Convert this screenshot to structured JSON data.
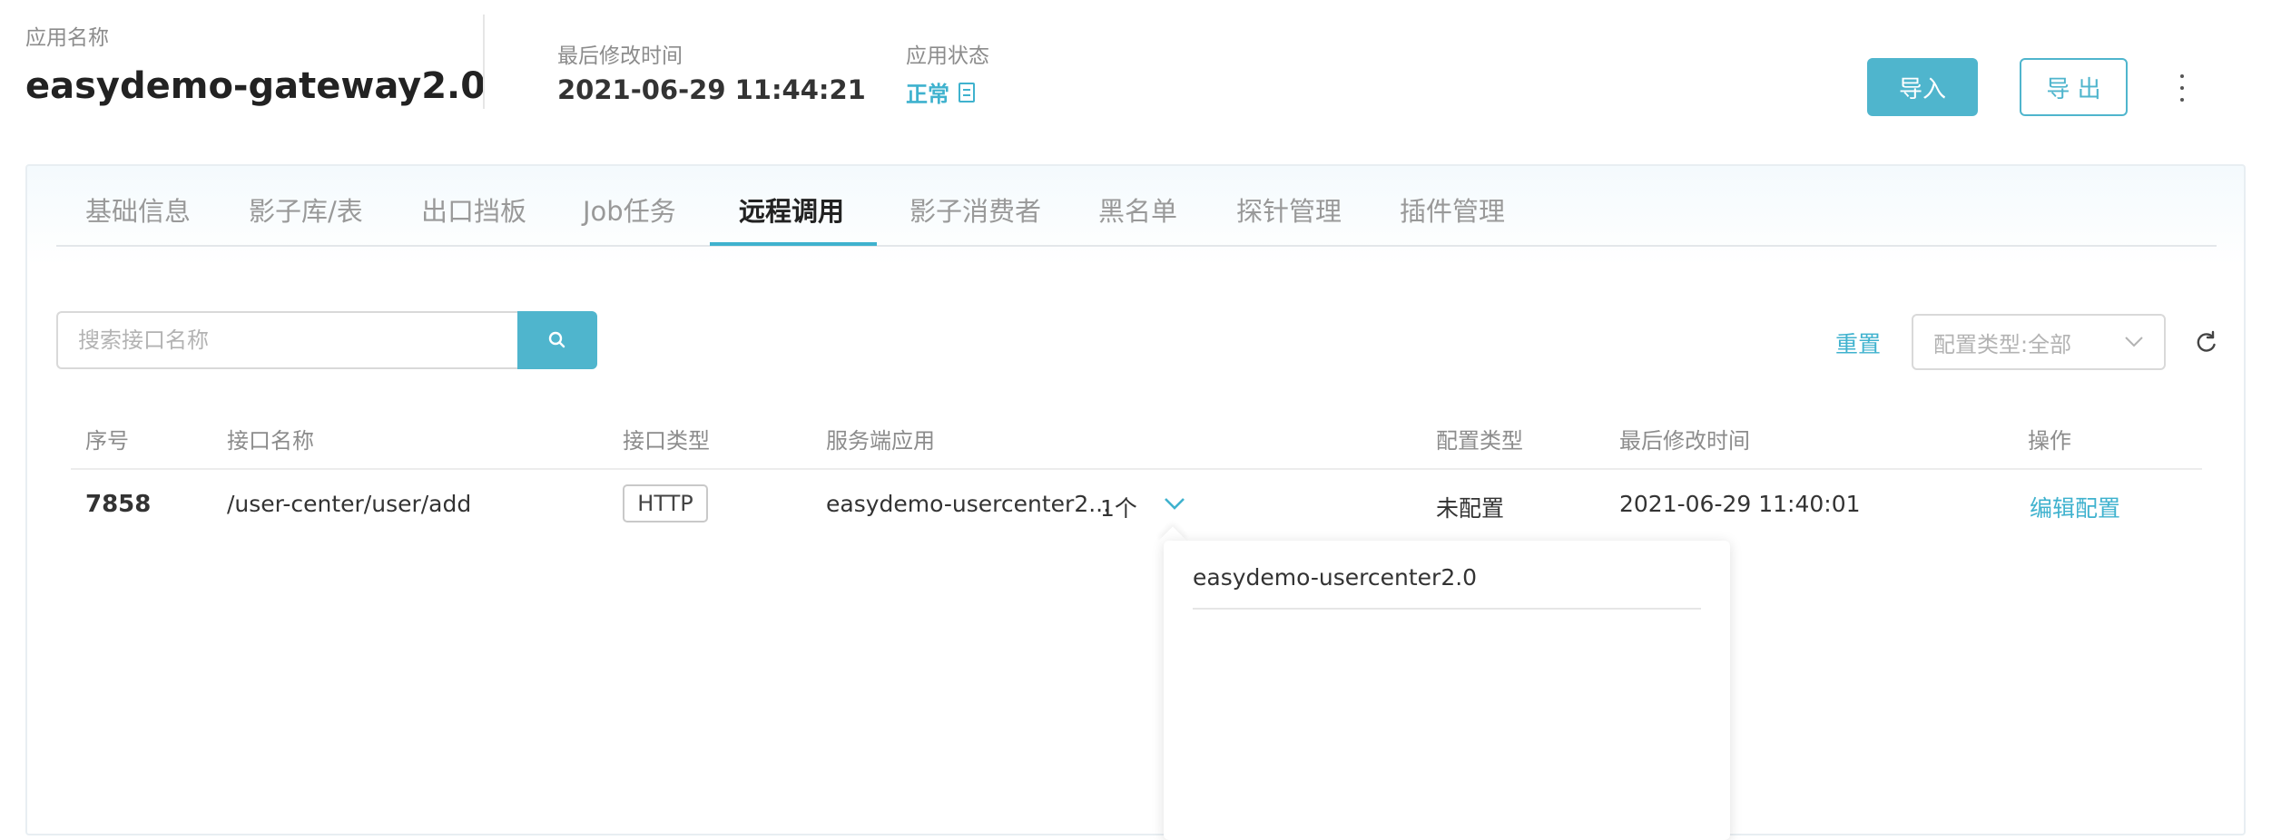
{
  "header": {
    "app_name_label": "应用名称",
    "app_name": "easydemo-gateway2.0",
    "last_modified_label": "最后修改时间",
    "last_modified": "2021-06-29 11:44:21",
    "status_label": "应用状态",
    "status": "正常",
    "import_label": "导入",
    "export_label": "导 出"
  },
  "tabs": [
    {
      "label": "基础信息"
    },
    {
      "label": "影子库/表"
    },
    {
      "label": "出口挡板"
    },
    {
      "label": "Job任务"
    },
    {
      "label": "远程调用",
      "active": true
    },
    {
      "label": "影子消费者"
    },
    {
      "label": "黑名单"
    },
    {
      "label": "探针管理"
    },
    {
      "label": "插件管理"
    }
  ],
  "toolbar": {
    "search_placeholder": "搜索接口名称",
    "reset_label": "重置",
    "config_type_select": "配置类型:全部"
  },
  "table": {
    "columns": [
      "序号",
      "接口名称",
      "接口类型",
      "服务端应用",
      "配置类型",
      "最后修改时间",
      "操作"
    ],
    "rows": [
      {
        "id": "7858",
        "interface": "/user-center/user/add",
        "type": "HTTP",
        "server_app": "easydemo-usercenter2...",
        "server_count": "1个",
        "config_type": "未配置",
        "modified": "2021-06-29 11:40:01",
        "action": "编辑配置"
      }
    ]
  },
  "popover": {
    "items": [
      "easydemo-usercenter2.0"
    ]
  },
  "colors": {
    "accent": "#4fb5cd",
    "link": "#3fb2ce"
  }
}
